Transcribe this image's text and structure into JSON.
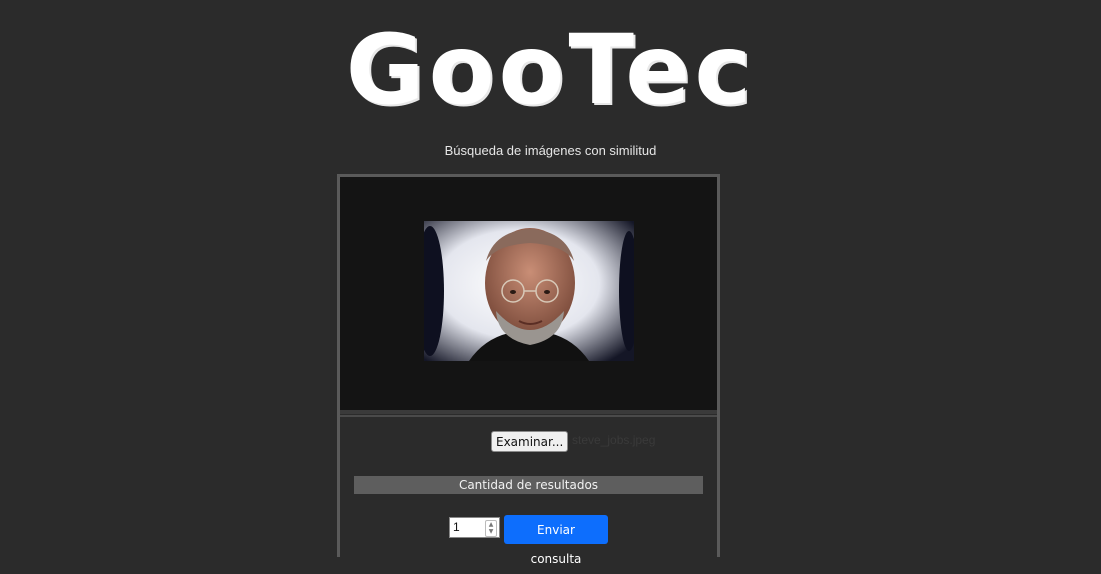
{
  "header": {
    "logo_text": "GooTec",
    "subtitle": "Búsqueda de imágenes con similitud"
  },
  "preview": {
    "image_description_icon": "portrait-photo"
  },
  "form": {
    "file_button_label": "Examinar...",
    "file_name": "steve_jobs.jpeg",
    "results_label": "Cantidad de resultados",
    "quantity_value": "1",
    "submit_label": "Enviar consulta"
  },
  "colors": {
    "background": "#2b2b2b",
    "panel_border": "#5a5a5a",
    "submit_button": "#0d6efd"
  }
}
